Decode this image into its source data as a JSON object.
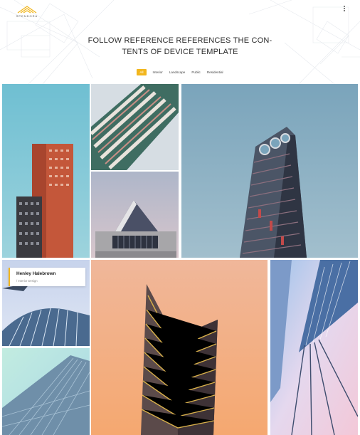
{
  "brand": {
    "name": "SPENDORA",
    "accent": "#f2b61d"
  },
  "header": {
    "title_line1": "FOLLOW REFERENCE REFERENCES THE CON-",
    "title_line2": "TENTS OF DEVICE TEMPLATE",
    "menu_icon": "kebab-menu-icon"
  },
  "filters": [
    {
      "label": "All",
      "active": true
    },
    {
      "label": "Interior",
      "active": false
    },
    {
      "label": "Landscape",
      "active": false
    },
    {
      "label": "Public",
      "active": false
    },
    {
      "label": "Residential",
      "active": false
    }
  ],
  "gallery": {
    "items": [
      {
        "subject": "red-brick-tower",
        "sky": "#77c2d3"
      },
      {
        "subject": "diagonal-balconies",
        "sky": "#cfd7de"
      },
      {
        "subject": "crown-skyscraper",
        "sky": "#86adbf"
      },
      {
        "subject": "angular-glass-building",
        "sky": "#c9c2cf"
      },
      {
        "subject": "curved-glass-tower",
        "sky": "#c6d3e8"
      },
      {
        "subject": "v-shaped-tower",
        "sky": "#f2ac7f"
      },
      {
        "subject": "bridge-cables",
        "sky": "#d9cbe3"
      },
      {
        "subject": "glass-facade",
        "sky": "#b9e1d9"
      }
    ],
    "caption": {
      "title": "Henley Halebrown",
      "subtitle": "/ Interior Design"
    }
  }
}
